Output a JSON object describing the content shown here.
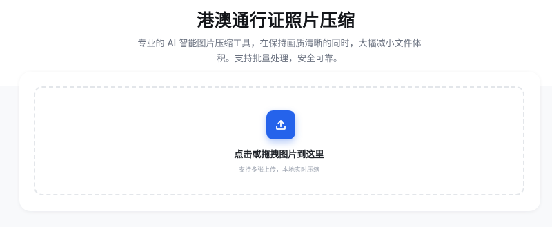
{
  "header": {
    "title": "港澳通行证照片压缩",
    "subtitle": "专业的 AI 智能图片压缩工具，在保持画质清晰的同时，大幅减小文件体积。支持批量处理，安全可靠。"
  },
  "upload": {
    "icon": "upload-icon",
    "title": "点击或拖拽图片到这里",
    "hint": "支持多张上传，本地实时压缩"
  },
  "colors": {
    "accent": "#2563eb",
    "title_text": "#14161a",
    "muted_text": "#6b7280",
    "page_background": "#f8f9fb",
    "dropzone_border": "#e3e6ea"
  }
}
